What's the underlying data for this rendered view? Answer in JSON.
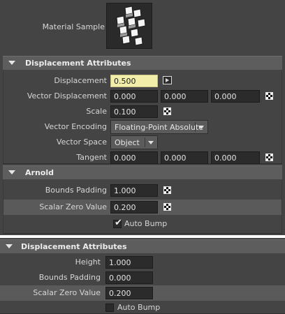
{
  "material_sample": {
    "label": "Material Sample"
  },
  "displacement_section": {
    "title": "Displacement Attributes",
    "displacement": {
      "label": "Displacement",
      "value": "0.500"
    },
    "vector_displacement": {
      "label": "Vector Displacement",
      "values": [
        "0.000",
        "0.000",
        "0.000"
      ]
    },
    "scale": {
      "label": "Scale",
      "value": "0.100"
    },
    "vector_encoding": {
      "label": "Vector Encoding",
      "value": "Floating-Point Absolute"
    },
    "vector_space": {
      "label": "Vector Space",
      "value": "Object"
    },
    "tangent": {
      "label": "Tangent",
      "values": [
        "0.000",
        "0.000",
        "0.000"
      ]
    }
  },
  "arnold_section": {
    "title": "Arnold",
    "bounds_padding": {
      "label": "Bounds Padding",
      "value": "1.000"
    },
    "scalar_zero_value": {
      "label": "Scalar Zero Value",
      "value": "0.200"
    },
    "auto_bump": {
      "label": "Auto Bump",
      "checked": true,
      "check_glyph": "✔"
    }
  },
  "displacement_section_2": {
    "title": "Displacement Attributes",
    "height": {
      "label": "Height",
      "value": "1.000"
    },
    "bounds_padding": {
      "label": "Bounds Padding",
      "value": "0.000"
    },
    "scalar_zero_value": {
      "label": "Scalar Zero Value",
      "value": "0.200"
    },
    "auto_bump": {
      "label": "Auto Bump",
      "checked": false
    }
  },
  "colors": {
    "panel_bg": "#444444",
    "header_bg": "#5d5d5d",
    "field_bg": "#2b2b2b",
    "active_field_bg": "#f2eeaa",
    "highlight_row": "#5a5a5a"
  }
}
